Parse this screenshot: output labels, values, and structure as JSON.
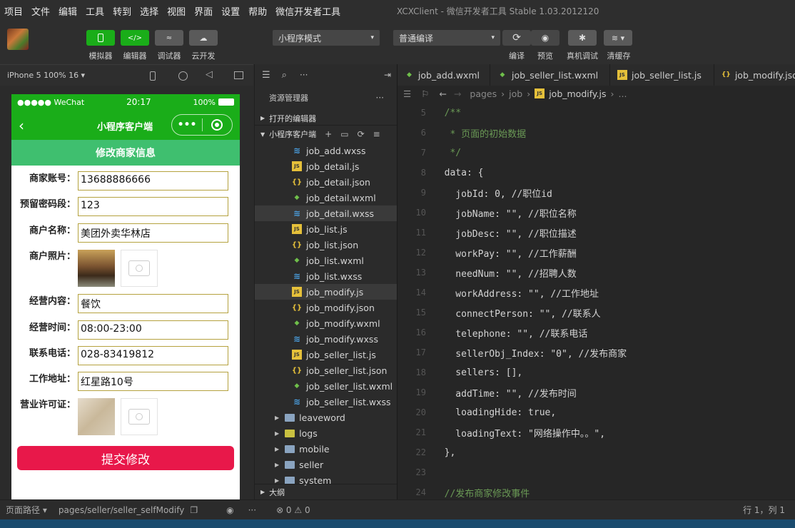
{
  "menubar": {
    "items": [
      "项目",
      "文件",
      "编辑",
      "工具",
      "转到",
      "选择",
      "视图",
      "界面",
      "设置",
      "帮助",
      "微信开发者工具"
    ],
    "title": "XCXClient - 微信开发者工具 Stable 1.03.2012120"
  },
  "toolbar": {
    "simulator": "模拟器",
    "editor": "编辑器",
    "debugger": "调试器",
    "cloud": "云开发",
    "mode_select": "小程序模式",
    "compile_select": "普通编译",
    "compile": "编译",
    "preview": "预览",
    "real_debug": "真机调试",
    "clear_cache": "清缓存",
    "accent": "#1aad19"
  },
  "simulator": {
    "device": "iPhone 5 100% 16 ▾",
    "status_carrier": "●●●●● WeChat",
    "status_time": "20:17",
    "status_battery": "100%",
    "nav_title": "小程序客户端",
    "page_title": "修改商家信息",
    "form": {
      "account_label": "商家账号：",
      "account_value": "13688886666",
      "pwd_label": "预留密码段：",
      "pwd_value": "123",
      "name_label": "商户名称：",
      "name_value": "美团外卖华林店",
      "photo_label": "商户照片：",
      "business_label": "经营内容：",
      "business_value": "餐饮",
      "time_label": "经营时间：",
      "time_value": "08:00-23:00",
      "phone_label": "联系电话：",
      "phone_value": "028-83419812",
      "address_label": "工作地址：",
      "address_value": "红星路10号",
      "license_label": "营业许可证："
    },
    "submit": "提交修改",
    "submit_color": "#e8184a"
  },
  "explorer": {
    "title": "资源管理器",
    "open_editors": "打开的编辑器",
    "project": "小程序客户端",
    "files": [
      {
        "name": "job_add.wxss",
        "type": "wxss"
      },
      {
        "name": "job_detail.js",
        "type": "js"
      },
      {
        "name": "job_detail.json",
        "type": "json"
      },
      {
        "name": "job_detail.wxml",
        "type": "wxml"
      },
      {
        "name": "job_detail.wxss",
        "type": "wxss"
      },
      {
        "name": "job_list.js",
        "type": "js"
      },
      {
        "name": "job_list.json",
        "type": "json"
      },
      {
        "name": "job_list.wxml",
        "type": "wxml"
      },
      {
        "name": "job_list.wxss",
        "type": "wxss"
      },
      {
        "name": "job_modify.js",
        "type": "js"
      },
      {
        "name": "job_modify.json",
        "type": "json"
      },
      {
        "name": "job_modify.wxml",
        "type": "wxml"
      },
      {
        "name": "job_modify.wxss",
        "type": "wxss"
      },
      {
        "name": "job_seller_list.js",
        "type": "js"
      },
      {
        "name": "job_seller_list.json",
        "type": "json"
      },
      {
        "name": "job_seller_list.wxml",
        "type": "wxml"
      },
      {
        "name": "job_seller_list.wxss",
        "type": "wxss"
      }
    ],
    "folders": [
      "leaveword",
      "logs",
      "mobile",
      "seller",
      "system"
    ],
    "outline": "大纲"
  },
  "editor": {
    "tabs": [
      "job_add.wxml",
      "job_seller_list.wxml",
      "job_seller_list.js",
      "job_modify.json"
    ],
    "crumbs": [
      "pages",
      "job",
      "job_modify.js",
      "..."
    ],
    "lines": [
      {
        "n": "5",
        "t": "  /**"
      },
      {
        "n": "6",
        "t": "   * 页面的初始数据"
      },
      {
        "n": "7",
        "t": "   */"
      },
      {
        "n": "8",
        "t": "  data: {"
      },
      {
        "n": "9",
        "t": "    jobId: 0, //职位id"
      },
      {
        "n": "10",
        "t": "    jobName: \"\", //职位名称"
      },
      {
        "n": "11",
        "t": "    jobDesc: \"\", //职位描述"
      },
      {
        "n": "12",
        "t": "    workPay: \"\", //工作薪酬"
      },
      {
        "n": "13",
        "t": "    needNum: \"\", //招聘人数"
      },
      {
        "n": "14",
        "t": "    workAddress: \"\", //工作地址"
      },
      {
        "n": "15",
        "t": "    connectPerson: \"\", //联系人"
      },
      {
        "n": "16",
        "t": "    telephone: \"\", //联系电话"
      },
      {
        "n": "17",
        "t": "    sellerObj_Index: \"0\", //发布商家"
      },
      {
        "n": "18",
        "t": "    sellers: [],"
      },
      {
        "n": "19",
        "t": "    addTime: \"\", //发布时间"
      },
      {
        "n": "20",
        "t": "    loadingHide: true,"
      },
      {
        "n": "21",
        "t": "    loadingText: \"网络操作中。。\","
      },
      {
        "n": "22",
        "t": "  },"
      },
      {
        "n": "23",
        "t": ""
      },
      {
        "n": "24",
        "t": "  //发布商家修改事件"
      }
    ]
  },
  "statusbar": {
    "page_path_label": "页面路径 ▾",
    "page_path": "pages/seller/seller_selfModify",
    "problems": "⊗ 0 ⚠ 0",
    "cursor": "行 1，列 1"
  }
}
